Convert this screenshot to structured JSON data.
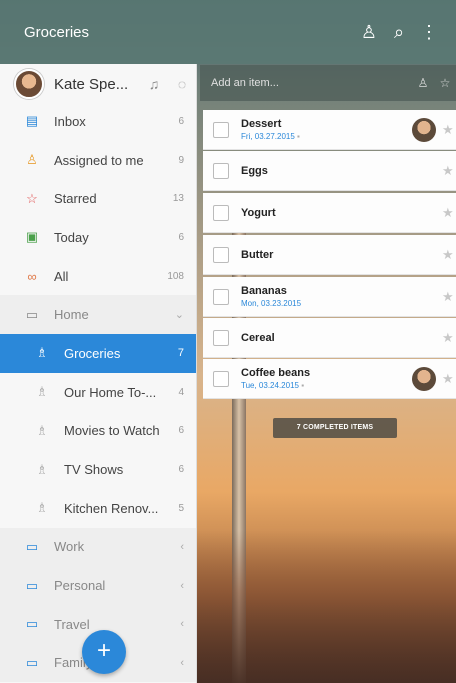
{
  "header": {
    "title": "Groceries"
  },
  "user": {
    "name": "Kate Spe..."
  },
  "sidebar": {
    "items": [
      {
        "label": "Inbox",
        "count": "6",
        "icon": "inbox-icon",
        "glyph": "▤",
        "color": "#2b88d9"
      },
      {
        "label": "Assigned to me",
        "count": "9",
        "icon": "person-icon",
        "glyph": "♙",
        "color": "#e8a23a"
      },
      {
        "label": "Starred",
        "count": "13",
        "icon": "star-icon",
        "glyph": "☆",
        "color": "#e05050"
      },
      {
        "label": "Today",
        "count": "6",
        "icon": "calendar-icon",
        "glyph": "▣",
        "color": "#4aa04a"
      },
      {
        "label": "All",
        "count": "108",
        "icon": "infinity-icon",
        "glyph": "∞",
        "color": "#e07a4a"
      }
    ],
    "home": {
      "label": "Home"
    },
    "lists": [
      {
        "label": "Groceries",
        "count": "7"
      },
      {
        "label": "Our Home To-...",
        "count": "4"
      },
      {
        "label": "Movies to Watch",
        "count": "6"
      },
      {
        "label": "TV Shows",
        "count": "6"
      },
      {
        "label": "Kitchen Renov...",
        "count": "5"
      }
    ],
    "folders": [
      {
        "label": "Work"
      },
      {
        "label": "Personal"
      },
      {
        "label": "Travel"
      },
      {
        "label": "Family"
      }
    ],
    "fab": "+"
  },
  "add_item": {
    "placeholder": "Add an item..."
  },
  "tasks": [
    {
      "name": "Dessert",
      "date": "Fri, 03.27.2015",
      "note": true,
      "avatar": true
    },
    {
      "name": "Eggs"
    },
    {
      "name": "Yogurt"
    },
    {
      "name": "Butter"
    },
    {
      "name": "Bananas",
      "date": "Mon, 03.23.2015"
    },
    {
      "name": "Cereal"
    },
    {
      "name": "Coffee beans",
      "date": "Tue, 03.24.2015",
      "note": true,
      "avatar": true
    }
  ],
  "completed_label": "7 COMPLETED ITEMS"
}
